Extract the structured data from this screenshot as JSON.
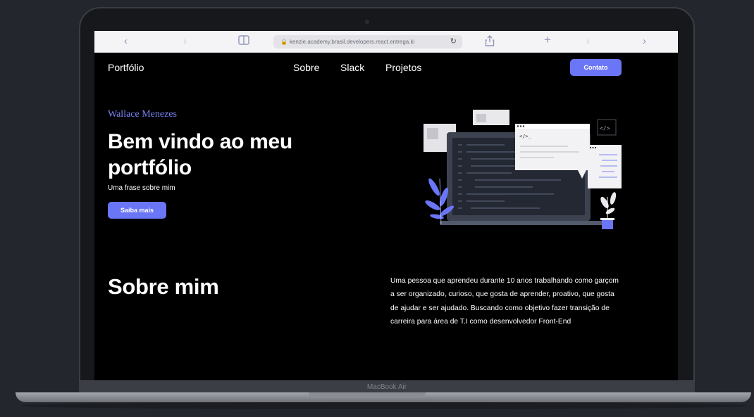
{
  "browser": {
    "url": "kenzie.academy.brasil.developers.react.entrega.ki",
    "icons": [
      "chevron-left-icon",
      "chevron-right-icon",
      "sidebar-icon",
      "lock-icon",
      "reload-icon",
      "share-icon",
      "plus-icon"
    ]
  },
  "nav": {
    "brand": "Portfólio",
    "links": [
      "Sobre",
      "Slack",
      "Projetos"
    ],
    "contact_label": "Contato"
  },
  "hero": {
    "name": "Wallace Menezes",
    "title": "Bem vindo ao meu portfólio",
    "subtitle": "Uma frase sobre mim",
    "button_label": "Saiba mais"
  },
  "about": {
    "title": "Sobre mim",
    "text": "Uma pessoa que aprendeu durante 10 anos trabalhando como garçom a ser organizado, curioso, que gosta de aprender, proativo, que gosta de ajudar e ser ajudado. Buscando como objetivo fazer transição de carreira para área de T.I como desenvolvedor Front-End"
  },
  "device": {
    "label": "MacBook Air"
  },
  "colors": {
    "accent": "#6a76f6",
    "background": "#000000"
  }
}
